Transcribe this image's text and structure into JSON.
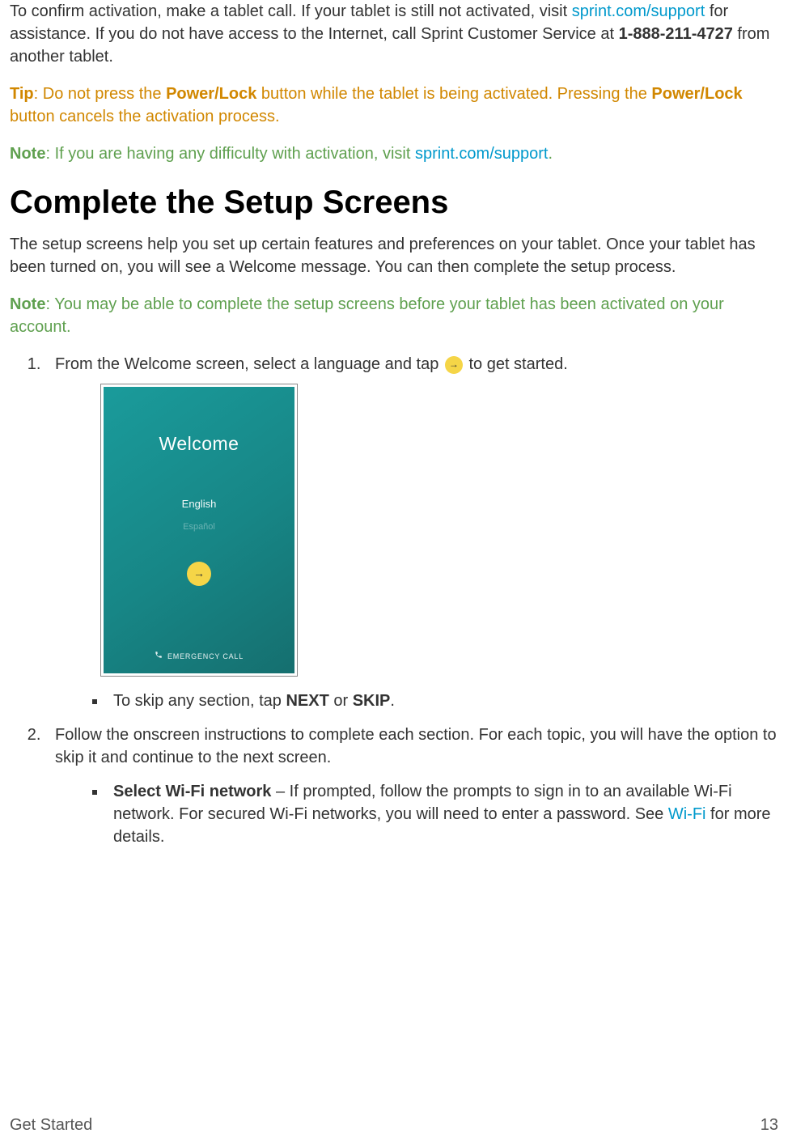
{
  "para1": {
    "t1": "To confirm activation, make a tablet call. If your tablet is still not activated, visit ",
    "link1": "sprint.com/support",
    "t2": " for assistance. If you do not have access to the Internet, call Sprint Customer Service at ",
    "phone": "1-888-211-4727",
    "t3": " from another tablet."
  },
  "tip": {
    "label": "Tip",
    "t1": ": Do not press the ",
    "b1": "Power/Lock",
    "t2": " button while the tablet is being activated. Pressing the ",
    "b2": "Power/Lock",
    "t3": " button cancels the activation process."
  },
  "note1": {
    "label": "Note",
    "t1": ": If you are having any difficulty with activation, visit ",
    "link": "sprint.com/support",
    "t2": "."
  },
  "heading": "Complete the Setup Screens",
  "para2": "The setup screens help you set up certain features and preferences on your tablet. Once your tablet has been turned on, you will see a Welcome message. You can then complete the setup process.",
  "note2": {
    "label": "Note",
    "t1": ": You may be able to complete the setup screens before your tablet has been activated on your account."
  },
  "step1": {
    "t1": "From the Welcome screen, select a language and tap ",
    "t2": " to get started."
  },
  "screenshot": {
    "title": "Welcome",
    "lang1": "English",
    "lang2": "Español",
    "emergency": "EMERGENCY CALL"
  },
  "bullet1": {
    "t1": "To skip any section, tap ",
    "b1": "NEXT",
    "t2": " or ",
    "b2": "SKIP",
    "t3": "."
  },
  "step2": "Follow the onscreen instructions to complete each section. For each topic, you will have the option to skip it and continue to the next screen.",
  "bullet2": {
    "b1": "Select Wi-Fi network",
    "t1": " – If prompted, follow the prompts to sign in to an available Wi-Fi network. For secured Wi-Fi networks, you will need to enter a password. See ",
    "link": "Wi-Fi",
    "t2": " for more details."
  },
  "footer": {
    "section": "Get Started",
    "page": "13"
  }
}
